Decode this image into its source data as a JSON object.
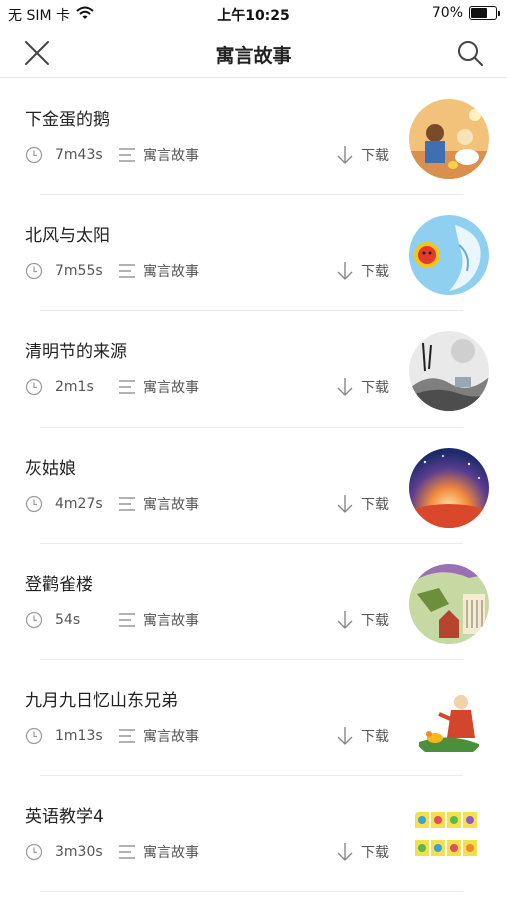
{
  "status": {
    "carrier": "无 SIM 卡",
    "time": "上午10:25",
    "battery_pct": "70%",
    "battery_level": 0.7,
    "wifi_icon": "wifi-icon",
    "battery_icon": "battery-icon"
  },
  "nav": {
    "title": "寓言故事",
    "close_icon": "close-icon",
    "search_icon": "search-icon"
  },
  "items": [
    {
      "title": "下金蛋的鹅",
      "duration": "7m43s",
      "category": "寓言故事",
      "download": "下载"
    },
    {
      "title": "北风与太阳",
      "duration": "7m55s",
      "category": "寓言故事",
      "download": "下载"
    },
    {
      "title": "清明节的来源",
      "duration": "2m1s",
      "category": "寓言故事",
      "download": "下载"
    },
    {
      "title": "灰姑娘",
      "duration": "4m27s",
      "category": "寓言故事",
      "download": "下载"
    },
    {
      "title": "登鹳雀楼",
      "duration": "54s",
      "category": "寓言故事",
      "download": "下载"
    },
    {
      "title": "九月九日忆山东兄弟",
      "duration": "1m13s",
      "category": "寓言故事",
      "download": "下载"
    },
    {
      "title": "英语教学4",
      "duration": "3m30s",
      "category": "寓言故事",
      "download": "下载"
    }
  ]
}
